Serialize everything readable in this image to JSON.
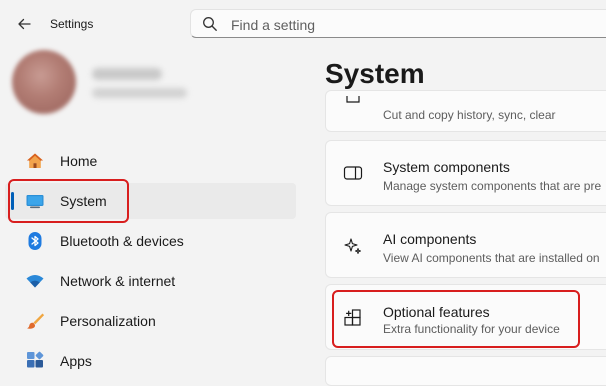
{
  "window": {
    "title": "Settings"
  },
  "search": {
    "placeholder": "Find a setting",
    "value": ""
  },
  "nav": {
    "items": [
      {
        "label": "Home"
      },
      {
        "label": "System",
        "selected": true
      },
      {
        "label": "Bluetooth & devices"
      },
      {
        "label": "Network & internet"
      },
      {
        "label": "Personalization"
      },
      {
        "label": "Apps"
      }
    ]
  },
  "main": {
    "title": "System",
    "cards": [
      {
        "title": "",
        "description": "Cut and copy history, sync, clear",
        "icon": "clipboard-icon"
      },
      {
        "title": "System components",
        "description": "Manage system components that are pre",
        "icon": "system-components-icon"
      },
      {
        "title": "AI components",
        "description": "View AI components that are installed on",
        "icon": "sparkle-icon"
      },
      {
        "title": "Optional features",
        "description": "Extra functionality for your device",
        "icon": "optional-features-icon"
      }
    ]
  },
  "colors": {
    "accent": "#005fb8",
    "highlight_box": "#d81e1e",
    "background": "#f3f3f3",
    "card": "#fbfbfb"
  }
}
